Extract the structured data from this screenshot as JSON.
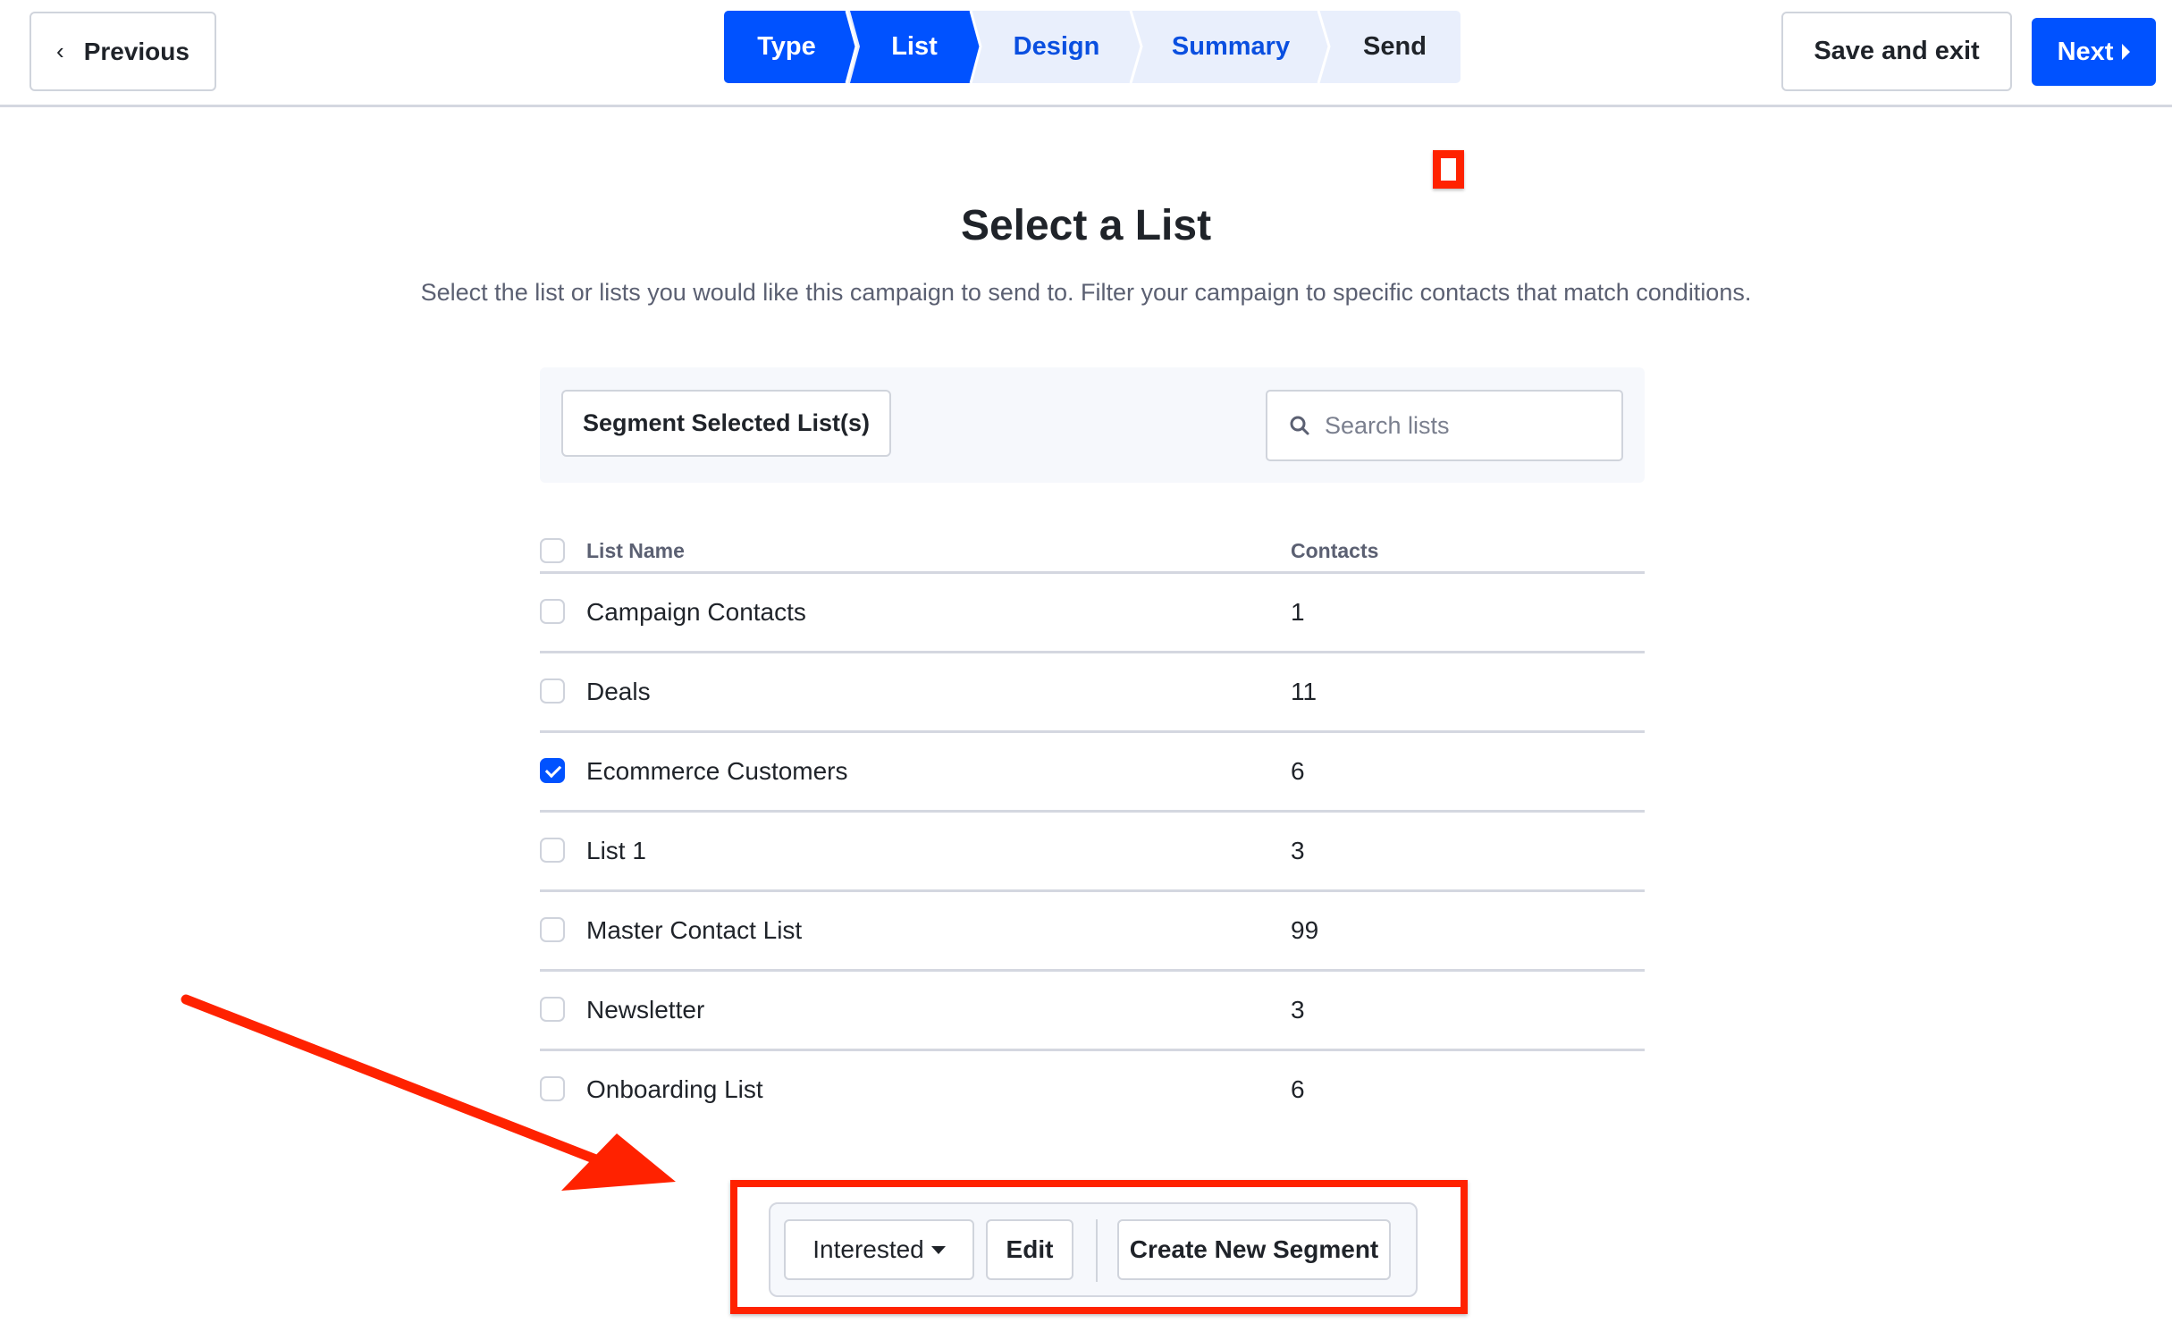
{
  "header": {
    "previous_label": "Previous",
    "previous_icon": "chevron-left-icon",
    "save_exit_label": "Save and exit",
    "next_label": "Next",
    "next_icon": "caret-right-icon",
    "steps": [
      {
        "label": "Type",
        "state": "completed"
      },
      {
        "label": "List",
        "state": "current"
      },
      {
        "label": "Design",
        "state": "upcoming"
      },
      {
        "label": "Summary",
        "state": "upcoming"
      },
      {
        "label": "Send",
        "state": "upcoming"
      }
    ]
  },
  "colors": {
    "accent": "#0052ff",
    "stepper_inactive_bg": "#e9effc",
    "annotation_red": "#ff2200",
    "border": "#d4d7e0",
    "muted_text": "#5b6072"
  },
  "main": {
    "title": "Select a List",
    "subtitle": "Select the list or lists you would like this campaign to send to. Filter your campaign to specific contacts that match conditions.",
    "segment_selected_label": "Segment Selected List(s)",
    "search": {
      "placeholder": "Search lists",
      "value": "",
      "icon": "search-icon"
    },
    "table": {
      "columns": [
        "List Name",
        "Contacts"
      ],
      "rows": [
        {
          "name": "Campaign Contacts",
          "contacts": "1",
          "checked": false
        },
        {
          "name": "Deals",
          "contacts": "11",
          "checked": false
        },
        {
          "name": "Ecommerce Customers",
          "contacts": "6",
          "checked": true
        },
        {
          "name": "List 1",
          "contacts": "3",
          "checked": false
        },
        {
          "name": "Master Contact List",
          "contacts": "99",
          "checked": false
        },
        {
          "name": "Newsletter",
          "contacts": "3",
          "checked": false
        },
        {
          "name": "Onboarding List",
          "contacts": "6",
          "checked": false
        }
      ]
    }
  },
  "segment_bar": {
    "selected_segment": "Interested",
    "edit_label": "Edit",
    "create_label": "Create New Segment"
  }
}
